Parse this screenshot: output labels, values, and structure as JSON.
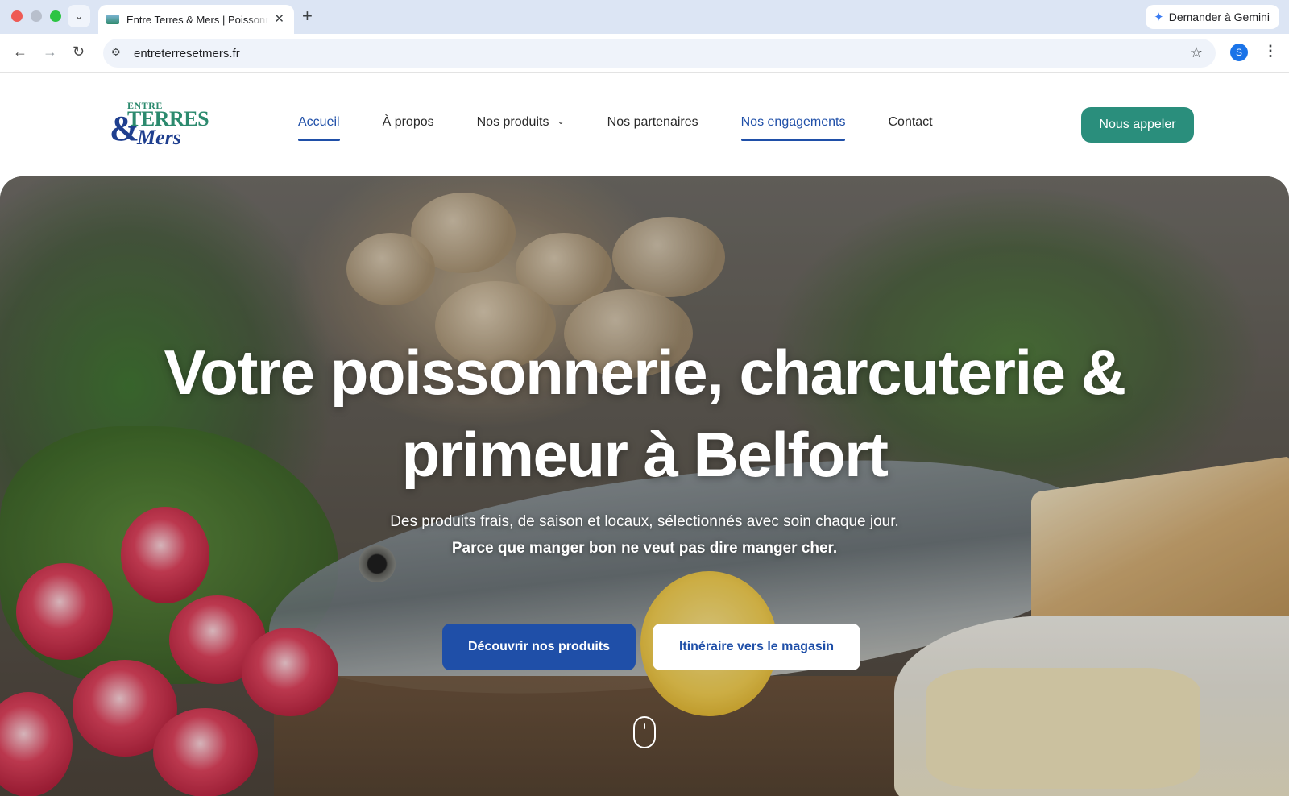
{
  "browser": {
    "tab_title": "Entre Terres & Mers | Poissonnerie",
    "new_tab_symbol": "+",
    "close_symbol": "✕",
    "gemini_label": "Demander à Gemini",
    "url": "entreterresetmers.fr",
    "profile_initial": "S"
  },
  "logo": {
    "entre": "ENTRE",
    "terres": "TERRES",
    "amp": "&",
    "mers": "Mers"
  },
  "nav": {
    "items": [
      {
        "label": "Accueil",
        "active": true
      },
      {
        "label": "À propos",
        "active": false
      },
      {
        "label": "Nos produits",
        "active": false,
        "dropdown": true
      },
      {
        "label": "Nos partenaires",
        "active": false
      },
      {
        "label": "Nos engagements",
        "active": true
      },
      {
        "label": "Contact",
        "active": false
      }
    ],
    "cta_label": "Nous appeler"
  },
  "hero": {
    "title_line1": "Votre poissonnerie, charcuterie &",
    "title_line2": "primeur à Belfort",
    "subtitle": "Des produits frais, de saison et locaux, sélectionnés avec soin chaque jour.",
    "tagline": "Parce que manger bon ne veut pas dire manger cher.",
    "primary_button": "Découvrir nos produits",
    "secondary_button": "Itinéraire vers le magasin"
  },
  "colors": {
    "brand_blue": "#1f4fa8",
    "brand_green": "#2a8e7c"
  }
}
